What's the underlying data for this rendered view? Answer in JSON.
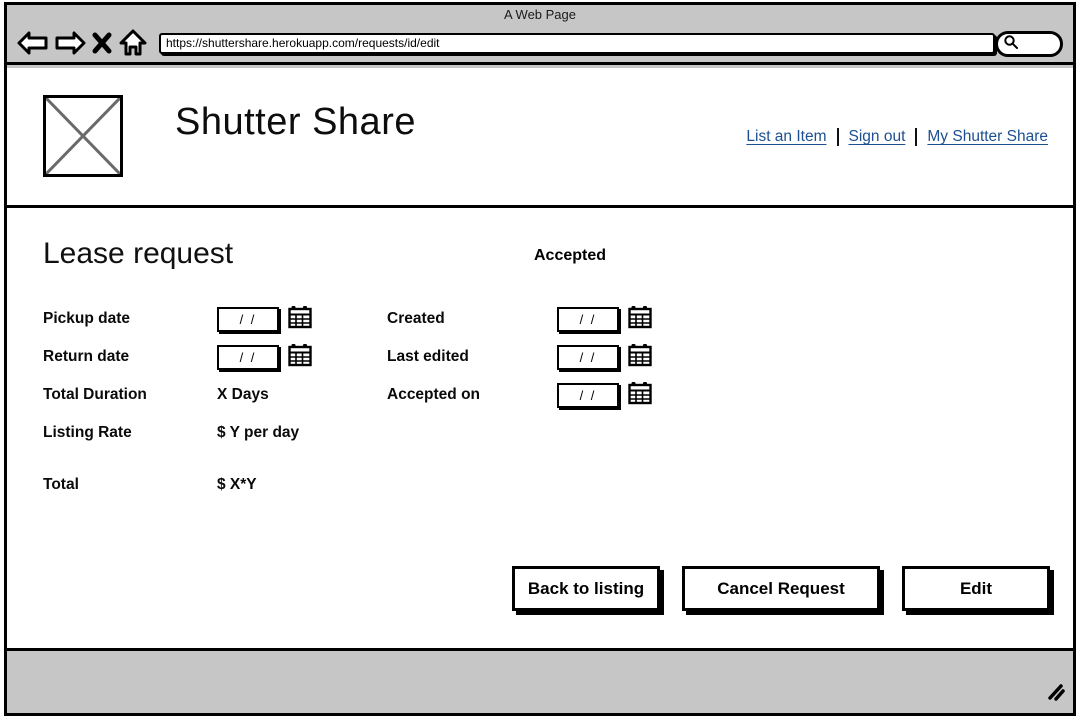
{
  "browser": {
    "window_title": "A Web Page",
    "url": "https://shuttershare.herokuapp.com/requests/id/edit",
    "search_placeholder": "",
    "icons": {
      "back": "back-arrow-icon",
      "forward": "forward-arrow-icon",
      "stop": "stop-x-icon",
      "home": "home-icon",
      "search": "search-icon",
      "resize": "resize-grip-icon"
    }
  },
  "site": {
    "brand": "Shutter Share",
    "logo": "image-placeholder-icon",
    "nav": [
      {
        "label": "List an Item"
      },
      {
        "label": "Sign out"
      },
      {
        "label": "My Shutter Share"
      }
    ]
  },
  "main": {
    "title": "Lease request",
    "status": "Accepted",
    "left_fields": [
      {
        "label": "Pickup date",
        "type": "date",
        "value": "/ /",
        "spaced": false
      },
      {
        "label": "Return date",
        "type": "date",
        "value": "/ /",
        "spaced": false
      },
      {
        "label": "Total Duration",
        "type": "text",
        "value": "X Days",
        "spaced": false
      },
      {
        "label": "Listing Rate",
        "type": "text",
        "value": "$ Y per day",
        "spaced": false
      },
      {
        "label": "Total",
        "type": "text",
        "value": "$ X*Y",
        "spaced": true
      }
    ],
    "right_fields": [
      {
        "label": "Created",
        "type": "date",
        "value": "/ /"
      },
      {
        "label": "Last edited",
        "type": "date",
        "value": "/ /"
      },
      {
        "label": "Accepted on",
        "type": "date",
        "value": "/ /"
      }
    ],
    "buttons": [
      {
        "label": "Back to listing",
        "name": "back-to-listing-button"
      },
      {
        "label": "Cancel Request",
        "name": "cancel-request-button"
      },
      {
        "label": "Edit",
        "name": "edit-button"
      }
    ]
  },
  "colors": {
    "link": "#1d4f91",
    "chrome": "#c6c6c6",
    "ink": "#000000",
    "page": "#ffffff"
  }
}
